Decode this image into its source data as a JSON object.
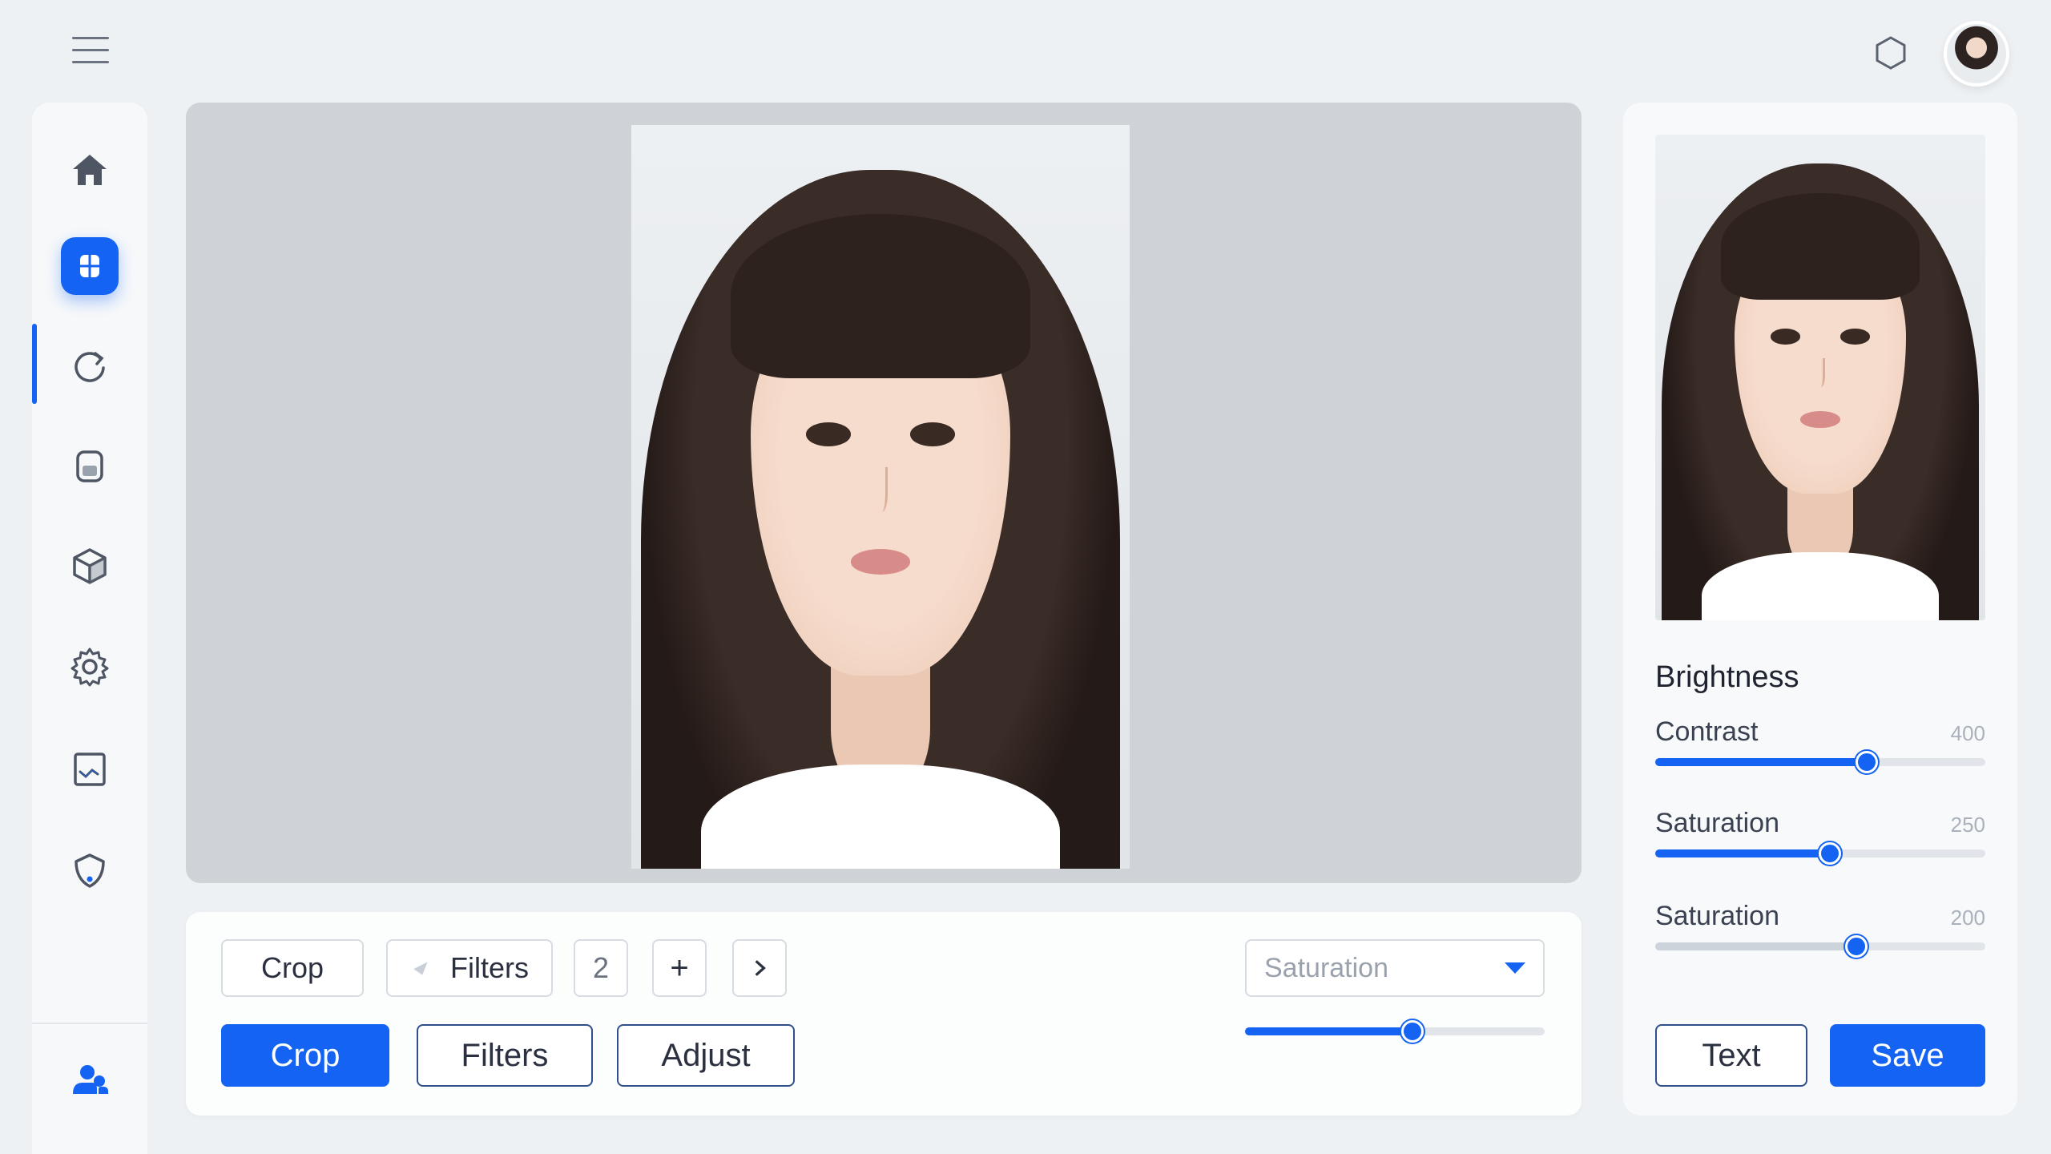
{
  "sidebar": {
    "items": [
      {
        "name": "home-icon"
      },
      {
        "name": "apps-icon",
        "active": true
      },
      {
        "name": "refresh-icon"
      },
      {
        "name": "layers-icon"
      },
      {
        "name": "cube-icon"
      },
      {
        "name": "settings-icon"
      },
      {
        "name": "chart-icon"
      },
      {
        "name": "shield-icon"
      }
    ],
    "bottom_icon": "users-icon"
  },
  "toolbar": {
    "row1": {
      "crop_label": "Crop",
      "filters_label": "Filters",
      "count_label": "2",
      "add_label": "+",
      "next_label": ">"
    },
    "row2": {
      "crop_label": "Crop",
      "filters_label": "Filters",
      "adjust_label": "Adjust"
    },
    "select": {
      "value": "Saturation"
    },
    "slider_value": 0.56
  },
  "panel": {
    "title": "Brightness",
    "adjustments": [
      {
        "label": "Contrast",
        "value": "400",
        "level": 0.64
      },
      {
        "label": "Saturation",
        "value": "250",
        "level": 0.53
      },
      {
        "label": "Saturation",
        "value": "200",
        "level": 0.61
      }
    ],
    "text_label": "Text",
    "save_label": "Save"
  },
  "colors": {
    "accent": "#1463f3",
    "background": "#eef1f4"
  }
}
